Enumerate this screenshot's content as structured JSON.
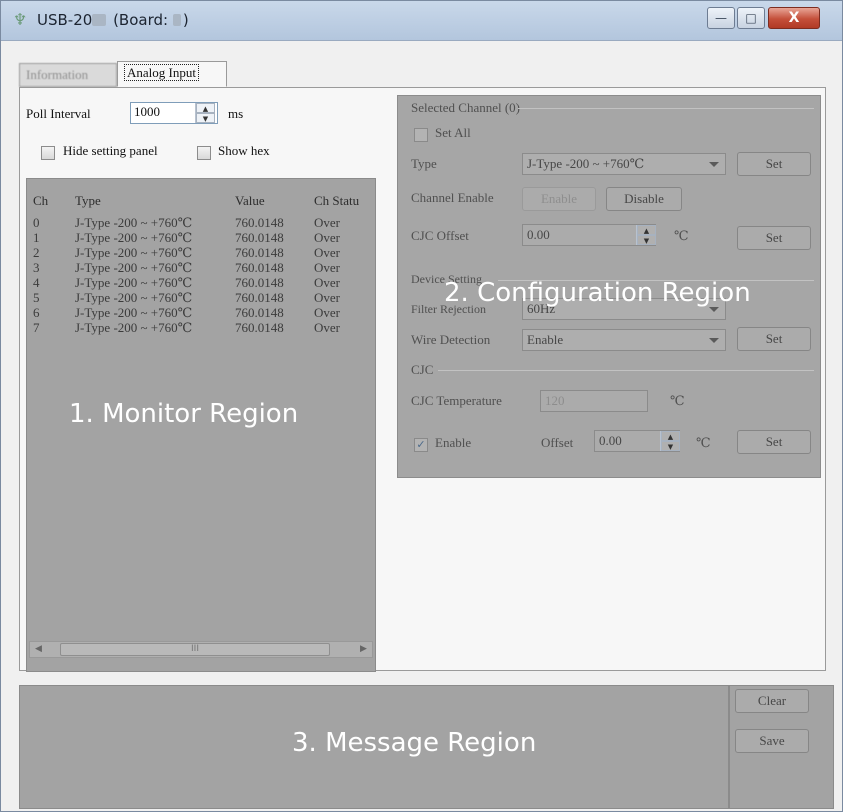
{
  "window": {
    "title_prefix": "USB-20",
    "title_suffix": "(Board:",
    "title_close_paren": ")",
    "min_glyph": "—",
    "max_glyph": "□",
    "close_glyph": "X"
  },
  "tabs": [
    {
      "label": "Information"
    },
    {
      "label": "Analog Input"
    }
  ],
  "toolbar": {
    "poll_interval_label": "Poll Interval",
    "poll_interval_value": "1000",
    "poll_unit": "ms",
    "hide_setting_panel_label": "Hide setting panel",
    "show_hex_label": "Show hex"
  },
  "monitor": {
    "columns": [
      "Ch",
      "Type",
      "Value",
      "Ch Statu"
    ],
    "rows": [
      {
        "ch": "0",
        "type": "J-Type -200 ~ +760℃",
        "value": "760.0148",
        "status": "Over"
      },
      {
        "ch": "1",
        "type": "J-Type -200 ~ +760℃",
        "value": "760.0148",
        "status": "Over"
      },
      {
        "ch": "2",
        "type": "J-Type -200 ~ +760℃",
        "value": "760.0148",
        "status": "Over"
      },
      {
        "ch": "3",
        "type": "J-Type -200 ~ +760℃",
        "value": "760.0148",
        "status": "Over"
      },
      {
        "ch": "4",
        "type": "J-Type -200 ~ +760℃",
        "value": "760.0148",
        "status": "Over"
      },
      {
        "ch": "5",
        "type": "J-Type -200 ~ +760℃",
        "value": "760.0148",
        "status": "Over"
      },
      {
        "ch": "6",
        "type": "J-Type -200 ~ +760℃",
        "value": "760.0148",
        "status": "Over"
      },
      {
        "ch": "7",
        "type": "J-Type -200 ~ +760℃",
        "value": "760.0148",
        "status": "Over"
      }
    ],
    "overlay_label": "1. Monitor Region",
    "scroll_left": "◀",
    "scroll_right": "▶",
    "scroll_grip": "III"
  },
  "config": {
    "selected_channel_title": "Selected Channel (0)",
    "set_all_label": "Set All",
    "type_label": "Type",
    "type_value": "J-Type -200 ~ +760℃",
    "set_label": "Set",
    "channel_enable_label": "Channel Enable",
    "enable_button": "Enable",
    "disable_button": "Disable",
    "cjc_offset_label": "CJC Offset",
    "cjc_offset_value": "0.00",
    "unit_celsius": "℃",
    "device_setting_title": "Device Setting",
    "filter_rejection_label": "Filter Rejection",
    "filter_rejection_value": "60Hz",
    "wire_detection_label": "Wire Detection",
    "wire_detection_value": "Enable",
    "cjc_title": "CJC",
    "cjc_temperature_label": "CJC Temperature",
    "cjc_temperature_value": "120",
    "cjc_enable_label": "Enable",
    "offset_label": "Offset",
    "offset_value": "0.00",
    "check_mark": "✓",
    "overlay_label": "2. Configuration Region"
  },
  "message": {
    "overlay_label": "3. Message Region",
    "clear_button": "Clear",
    "save_button": "Save"
  },
  "spin": {
    "up": "▲",
    "down": "▼"
  }
}
